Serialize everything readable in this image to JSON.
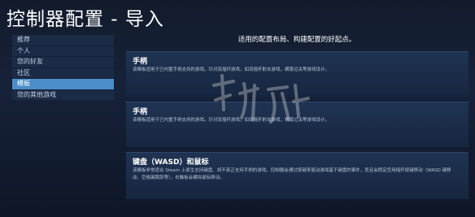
{
  "header": {
    "title": "控制器配置 - 导入"
  },
  "sidebar": {
    "items": [
      {
        "label": "推荐"
      },
      {
        "label": "个人"
      },
      {
        "label": "您的好友"
      },
      {
        "label": "社区"
      },
      {
        "label": "模板"
      },
      {
        "label": "您的其他游戏"
      }
    ],
    "selected_index": 4
  },
  "main": {
    "tagline": "适用的配置布局、构建配置的好起点。",
    "cards": [
      {
        "title": "手柄",
        "description": "该模板适用于已内置手柄支持的游戏。针对双摇杆游戏，如双摇杆射击游戏，横版过关等游戏设计。"
      },
      {
        "title": "手柄",
        "description": "该模板适用于已内置手柄支持的游戏。针对双摇杆游戏，如双摇杆射击游戏，横版过关等游戏设计。"
      },
      {
        "title": "键盘（WASD）和鼠标",
        "description": "该模板非常适合 Steam 上原生支持键盘、却不真正支持手柄的游戏。控制器会通过按键来驱动游戏基于键盘的事件，而且会假定您用摇杆按键移动（WASD 键移动、空格键跳跃等），右触板会模拟鼠标移动。"
      }
    ]
  },
  "colors": {
    "background": "#16223a",
    "sidebar_item": "#1c2b45",
    "sidebar_selected": "#4b8ec9",
    "card": "#1f3352"
  }
}
